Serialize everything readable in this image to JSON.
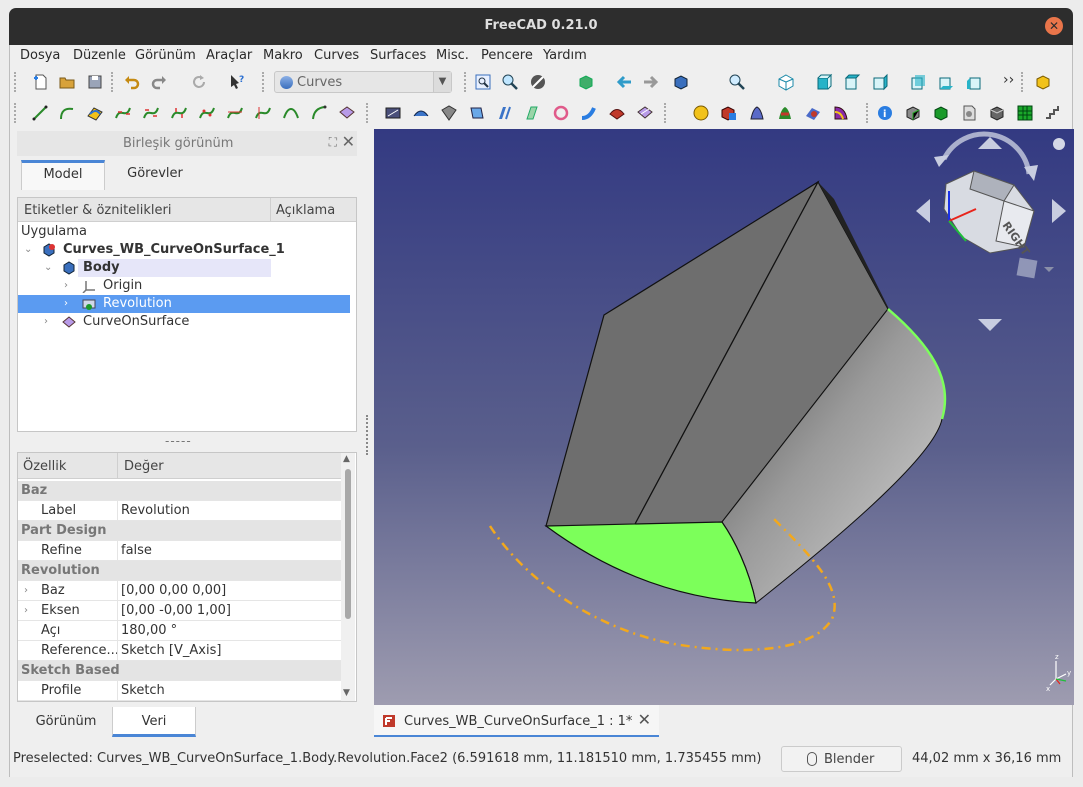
{
  "window": {
    "title": "FreeCAD 0.21.0"
  },
  "menu": [
    "Dosya",
    "Düzenle",
    "Görünüm",
    "Araçlar",
    "Makro",
    "Curves",
    "Surfaces",
    "Misc.",
    "Pencere",
    "Yardım"
  ],
  "workbench": {
    "selected": "Curves"
  },
  "combo_view": {
    "title": "Birleşik görünüm"
  },
  "top_tabs": [
    "Model",
    "Görevler"
  ],
  "tree": {
    "headers": [
      "Etiketler & öznitelikleri",
      "Açıklama"
    ],
    "section": "Uygulama",
    "document": "Curves_WB_CurveOnSurface_1",
    "body": "Body",
    "origin": "Origin",
    "revolution": "Revolution",
    "curve_on_surface": "CurveOnSurface"
  },
  "props": {
    "headers": [
      "Özellik",
      "Değer"
    ],
    "groups": {
      "baz": "Baz",
      "part_design": "Part Design",
      "revolution": "Revolution",
      "sketch_based": "Sketch Based"
    },
    "rows": {
      "label": {
        "k": "Label",
        "v": "Revolution"
      },
      "refine": {
        "k": "Refine",
        "v": "false"
      },
      "baz": {
        "k": "Baz",
        "v": "[0,00 0,00 0,00]"
      },
      "eksen": {
        "k": "Eksen",
        "v": "[0,00 -0,00 1,00]"
      },
      "aci": {
        "k": "Açı",
        "v": "180,00 °"
      },
      "reference": {
        "k": "Reference...",
        "v": "Sketch [V_Axis]"
      },
      "profile": {
        "k": "Profile",
        "v": "Sketch"
      }
    }
  },
  "bottom_tabs": [
    "Görünüm",
    "Veri"
  ],
  "doc_tab": {
    "label": "Curves_WB_CurveOnSurface_1 : 1*"
  },
  "navcube": {
    "face": "RIGHT"
  },
  "status": {
    "message": "Preselected: Curves_WB_CurveOnSurface_1.Body.Revolution.Face2 (6.591618 mm, 11.181510 mm, 1.735455 mm)",
    "nav_style": "Blender",
    "dimensions": "44,02 mm x 36,16 mm"
  },
  "colors": {
    "accent": "#4a86d6",
    "selection": "#5b9bf1",
    "highlight": "#7cff5a",
    "curve": "#f2a81d"
  }
}
